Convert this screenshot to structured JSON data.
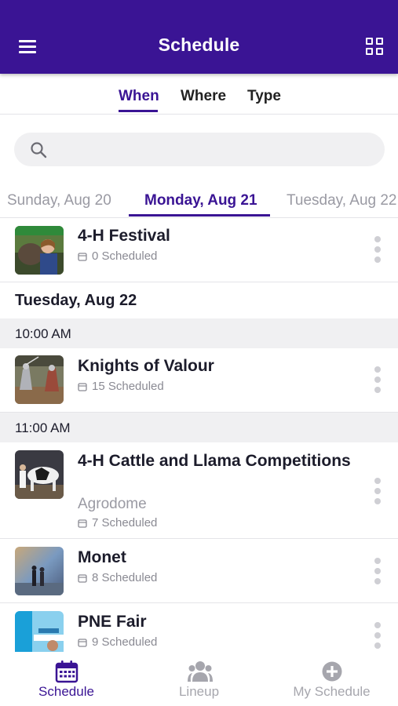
{
  "header": {
    "title": "Schedule",
    "menu_icon": "hamburger-menu-icon",
    "grid_icon": "grid-view-icon"
  },
  "filter_tabs": [
    {
      "label": "When",
      "active": true
    },
    {
      "label": "Where",
      "active": false
    },
    {
      "label": "Type",
      "active": false
    }
  ],
  "search": {
    "placeholder": "",
    "icon": "search-icon"
  },
  "day_tabs": [
    {
      "label": "Sunday, Aug 20",
      "active": false
    },
    {
      "label": "Monday, Aug 21",
      "active": true
    },
    {
      "label": "Tuesday, Aug 22",
      "active": false
    }
  ],
  "events": [
    {
      "name": "4-H Festival",
      "scheduled": "0 Scheduled"
    },
    {
      "name": "Knights of Valour",
      "scheduled": "15 Scheduled"
    },
    {
      "name": "4-H Cattle and Llama Competitions",
      "venue": "Agrodome",
      "scheduled": "7 Scheduled"
    },
    {
      "name": "Monet",
      "scheduled": "8 Scheduled"
    },
    {
      "name": "PNE Fair",
      "scheduled": "9 Scheduled"
    }
  ],
  "date_header": "Tuesday, Aug 22",
  "time_headers": [
    "10:00 AM",
    "11:00 AM"
  ],
  "bottom_nav": [
    {
      "label": "Schedule",
      "icon": "calendar-icon",
      "active": true
    },
    {
      "label": "Lineup",
      "icon": "people-icon",
      "active": false
    },
    {
      "label": "My Schedule",
      "icon": "plus-circle-icon",
      "active": false
    }
  ],
  "colors": {
    "primary": "#3a1494",
    "muted": "#9a9aa3",
    "divider": "#e4e4e8",
    "section_bg": "#f0f0f2"
  }
}
